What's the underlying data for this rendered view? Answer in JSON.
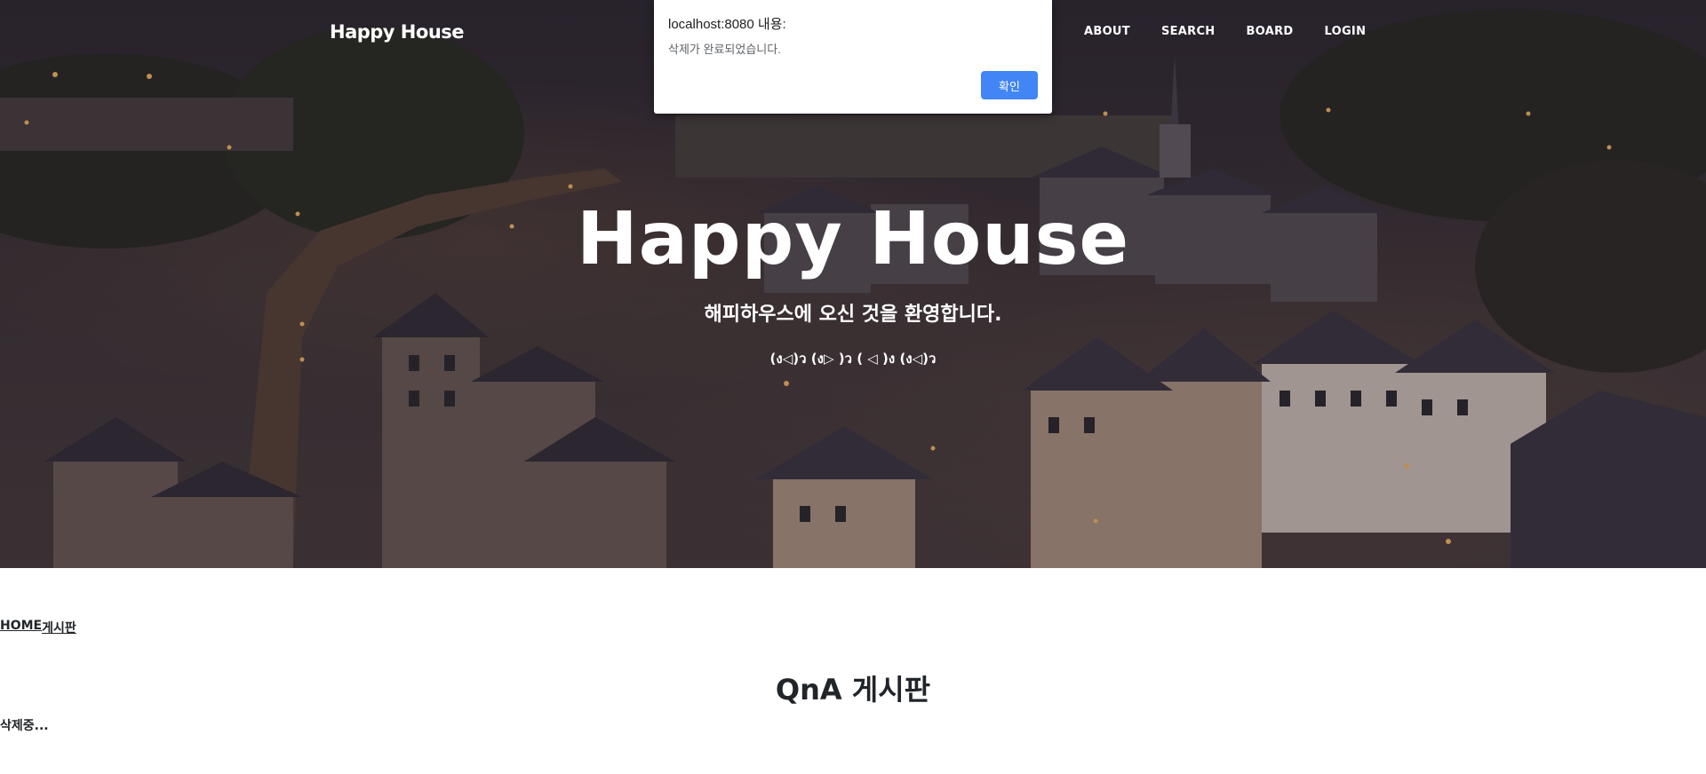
{
  "nav": {
    "brand": "Happy House",
    "links": [
      "ABOUT",
      "SEARCH",
      "BOARD",
      "LOGIN"
    ]
  },
  "hero": {
    "title": "Happy House",
    "subtitle": "해피하우스에 오신 것을 환영합니다.",
    "kaomoji": "(ง◁)ว (ง▷ )ว ( ◁ )ง (ง◁)ว"
  },
  "dialog": {
    "title": "localhost:8080 내용:",
    "message": "삭제가 완료되었습니다.",
    "ok_label": "확인"
  },
  "breadcrumb": {
    "home": "HOME",
    "current": "게시판"
  },
  "page": {
    "title": "QnA 게시판",
    "status": "삭제중..."
  },
  "colors": {
    "dialog_button": "#4285f4",
    "hero_overlay": "#2f2a33",
    "text": "#212529"
  }
}
